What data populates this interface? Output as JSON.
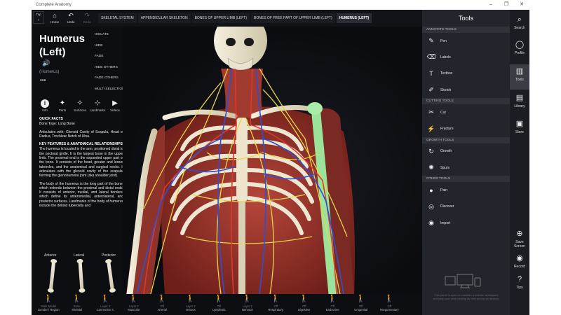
{
  "window": {
    "title": "Complete Anatomy",
    "controls": [
      "–",
      "❐",
      "✕"
    ]
  },
  "toolbar": {
    "back_label": "Tap\n+",
    "buttons": [
      {
        "glyph": "⌂",
        "label": "Home"
      },
      {
        "glyph": "↶",
        "label": "Undo"
      },
      {
        "glyph": "↷",
        "label": "Redo"
      }
    ],
    "breadcrumbs": [
      "SKELETAL SYSTEM",
      "APPENDICULAR SKELETON",
      "BONES OF UPPER LIMB (LEFT)",
      "BONES OF FREE PART OF UPPER LIMB (LEFT)",
      "HUMERUS (LEFT)"
    ]
  },
  "structure": {
    "title_line1": "Humerus",
    "title_line2": "(Left)",
    "speaker_icon": "🔊",
    "latin_name": "(Humerus)",
    "more": "•••"
  },
  "context_menu": [
    "ISOLATE",
    "HIDE",
    "FADE",
    "HIDE OTHERS",
    "FADE OTHERS",
    "MULTI SELECTION"
  ],
  "tabs": [
    {
      "icon": "i",
      "label": "Info"
    },
    {
      "icon": "✦",
      "label": "Parts"
    },
    {
      "icon": "✧",
      "label": "Surfaces"
    },
    {
      "icon": "⊹",
      "label": "Landmarks"
    },
    {
      "icon": "▶",
      "label": "Videos"
    }
  ],
  "info": {
    "quick_facts_heading": "QUICK FACTS",
    "bone_type": "Bone Type: Long Bone",
    "articulates": "Articulates with: Glenoid Cavity of Scapula, Head of Radius, Trochlear Notch of Ulna.",
    "features_heading": "KEY FEATURES & ANATOMICAL RELATIONSHIPS",
    "para1": "The humerus is located in the arm, positioned distal to the pectoral girdle. It is the largest bone in the upper limb. The proximal end is the expanded upper part of the bone. It consists of the head, greater and lesser tubercles, and the anatomical and surgical necks. It articulates with the glenoid cavity of the scapula, forming the glenohumeral joint (aka shoulder joint).",
    "para2": "The body of the humerus is the long part of the bone, which extends between the proximal and distal ends. It consists of anterior, medial, and lateral borders, which define its anteromedial, anterolateral, and posterior surfaces. Landmarks of the body of humerus include the deltoid tuberosity and"
  },
  "bone_views": [
    "Anterior",
    "Lateral",
    "Posterior"
  ],
  "layers": [
    {
      "state": "Male Model",
      "label": "Gender / Region"
    },
    {
      "state": "Bone",
      "label": "Skeletal"
    },
    {
      "state": "Layer 3",
      "label": "Connective T."
    },
    {
      "state": "Layer 2",
      "label": "Muscular"
    },
    {
      "state": "Off",
      "label": "Arterial"
    },
    {
      "state": "Layer 2",
      "label": "Venous"
    },
    {
      "state": "Off",
      "label": "Lymphatic"
    },
    {
      "state": "Layer 2",
      "label": "Nervous"
    },
    {
      "state": "Off",
      "label": "Respiratory"
    },
    {
      "state": "Off",
      "label": "Digestive"
    },
    {
      "state": "Off",
      "label": "Endocrine"
    },
    {
      "state": "Off",
      "label": "Urogenital"
    },
    {
      "state": "Off",
      "label": "Integumentary"
    }
  ],
  "tools": {
    "title": "Tools",
    "sections": [
      {
        "heading": "ANNOTATE TOOLS",
        "items": [
          {
            "icon": "✎",
            "label": "Pen"
          },
          {
            "icon": "⌫",
            "label": "Labels"
          },
          {
            "icon": "T",
            "label": "Textbox"
          },
          {
            "icon": "✐",
            "label": "Sketch"
          }
        ]
      },
      {
        "heading": "CUTTING TOOLS",
        "items": [
          {
            "icon": "✂",
            "label": "Cut"
          },
          {
            "icon": "⚡",
            "label": "Fracture"
          }
        ]
      },
      {
        "heading": "GROWTH TOOLS",
        "items": [
          {
            "icon": "↻",
            "label": "Growth"
          },
          {
            "icon": "✺",
            "label": "Spurs"
          }
        ]
      },
      {
        "heading": "OTHER TOOLS",
        "items": [
          {
            "icon": "●",
            "label": "Pain"
          },
          {
            "icon": "◎",
            "label": "Discover"
          },
          {
            "icon": "◉",
            "label": "Import"
          }
        ]
      }
    ],
    "note": "This panel is open to maintain a uniform workspace and help your work looking its best across all devices."
  },
  "sidebar": [
    {
      "icon": "⌕",
      "label": "Search"
    },
    {
      "icon": "◯",
      "label": "Profile"
    },
    {
      "icon": "▥",
      "label": "Tools"
    },
    {
      "icon": "▤",
      "label": "Library"
    },
    {
      "icon": "▣",
      "label": "Store"
    },
    {
      "icon": "⊕",
      "label": "Save Screen"
    },
    {
      "icon": "◉",
      "label": "Record"
    },
    {
      "icon": "?",
      "label": "Tips"
    }
  ],
  "colors": {
    "bone": "#e9e3cf",
    "humerus_highlight": "#9be39b",
    "nerve": "#e8d64a",
    "artery": "#d93a2c",
    "vein": "#2d4fd6"
  }
}
